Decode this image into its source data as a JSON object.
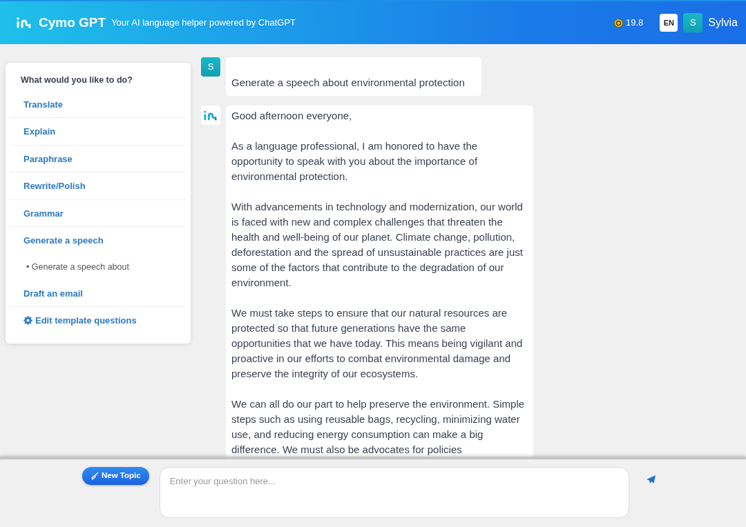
{
  "header": {
    "brand": "Cymo GPT",
    "tagline": "Your AI language helper powered by ChatGPT",
    "credits": "19.8",
    "language": "EN",
    "avatar": "S",
    "user": "Sylvia"
  },
  "sidebar": {
    "title": "What would you like to do?",
    "items": [
      {
        "label": "Translate",
        "kind": "link"
      },
      {
        "label": "Explain",
        "kind": "link"
      },
      {
        "label": "Paraphrase",
        "kind": "link"
      },
      {
        "label": "Rewrite/Polish",
        "kind": "link"
      },
      {
        "label": "Grammar",
        "kind": "link"
      },
      {
        "label": "Generate a speech",
        "kind": "link"
      },
      {
        "label": "• Generate a speech about",
        "kind": "example"
      },
      {
        "label": "Draft an email",
        "kind": "link"
      },
      {
        "label": "Edit template questions",
        "kind": "settings"
      }
    ]
  },
  "messages": [
    {
      "kind": "user",
      "avatar": "S",
      "paragraphs": [
        "Generate a speech about environmental protection"
      ]
    },
    {
      "kind": "assistant",
      "paragraphs": [
        "Good afternoon everyone,",
        "As a language professional, I am honored to have the opportunity to speak with you about the importance of environmental protection.",
        "With advancements in technology and modernization, our world is faced with new and complex challenges that threaten the health and well-being of our planet. Climate change, pollution, deforestation and the spread of unsustainable practices are just some of the factors that contribute to the degradation of our environment.",
        "We must take steps to ensure that our natural resources are protected so that future generations have the same opportunities that we have today. This means being vigilant and proactive in our efforts to combat environmental damage and preserve the integrity of our ecosystems.",
        "We can all do our part to help preserve the environment. Simple steps such as using reusable bags, recycling, minimizing water use, and reducing energy consumption can make a big difference. We must also be advocates for policies"
      ]
    }
  ],
  "composer": {
    "new_topic": "New Topic",
    "placeholder": "Enter your question here..."
  }
}
